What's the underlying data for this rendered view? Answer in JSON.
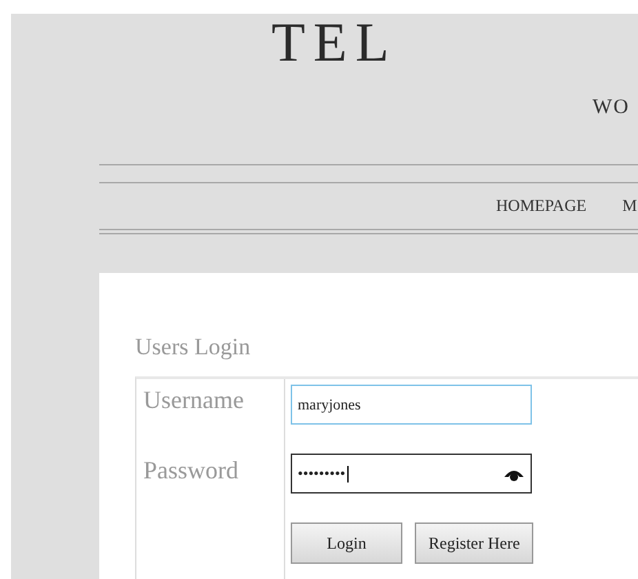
{
  "header": {
    "logo": "TEL",
    "tagline": "WO"
  },
  "nav": {
    "items": [
      {
        "label": "HOMEPAGE"
      },
      {
        "label": "M"
      }
    ]
  },
  "login": {
    "title": "Users Login",
    "fields": [
      {
        "label": "Username",
        "kind": "text",
        "value": "maryjones",
        "focused": true
      },
      {
        "label": "Password",
        "kind": "password",
        "value": "•••••••••",
        "focused": false
      }
    ],
    "buttons": [
      "Login",
      "Register Here"
    ]
  }
}
